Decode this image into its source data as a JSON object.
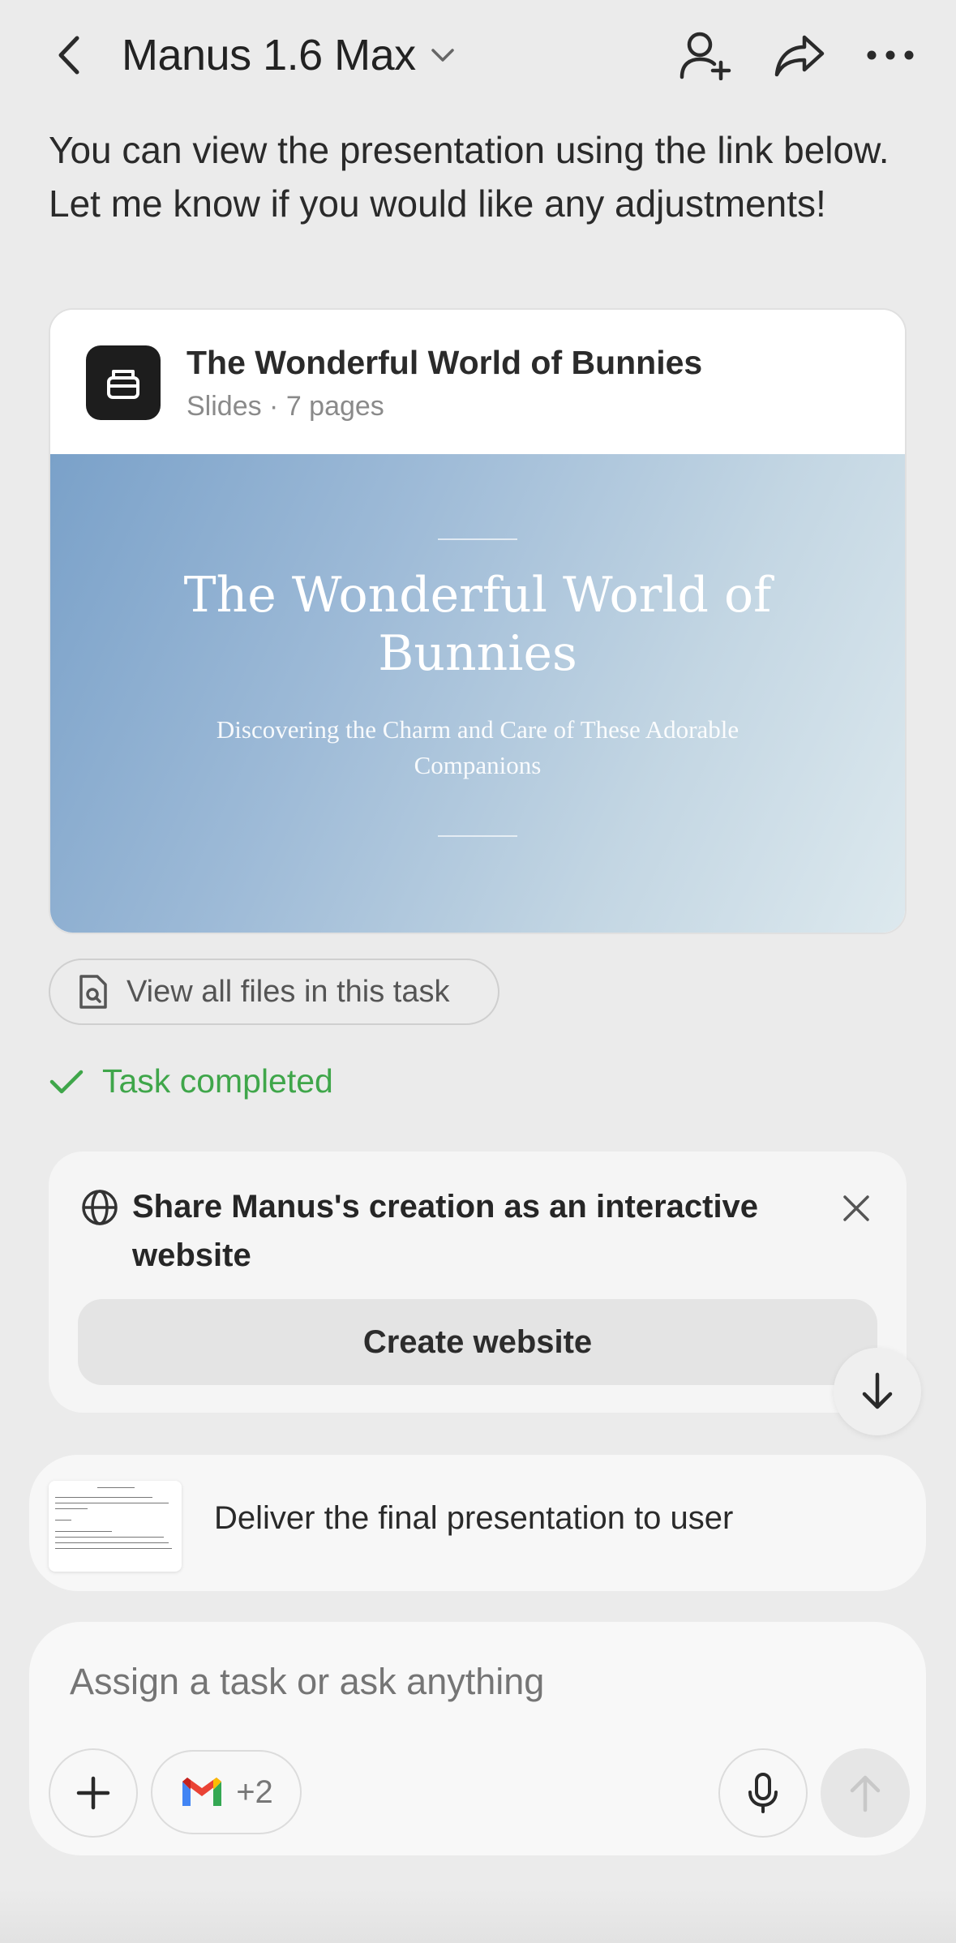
{
  "header": {
    "title": "Manus 1.6 Max"
  },
  "message": {
    "text": "You can view the presentation using the link below. Let me know if you would like any adjustments!"
  },
  "file_card": {
    "title": "The Wonderful World of Bunnies",
    "subtitle": "Slides · 7 pages",
    "slide_title": "The Wonderful World of Bunnies",
    "slide_subtitle": "Discovering the Charm and Care of These Adorable Companions"
  },
  "files_button": {
    "label": "View all files in this task"
  },
  "status": {
    "label": "Task completed",
    "color": "#3fa64a"
  },
  "share_prompt": {
    "title": "Share Manus's creation as an interactive website",
    "button_label": "Create website"
  },
  "step": {
    "label": "Deliver the final presentation to user"
  },
  "composer": {
    "placeholder": "Assign a task or ask anything",
    "connectors_count": "+2"
  },
  "icons": [
    "chevron-left-icon",
    "chevron-down-icon",
    "add-user-icon",
    "share-icon",
    "more-icon",
    "file-search-icon",
    "check-icon",
    "globe-icon",
    "close-icon",
    "arrow-down-icon",
    "plus-icon",
    "gmail-icon",
    "microphone-icon",
    "arrow-up-icon"
  ]
}
